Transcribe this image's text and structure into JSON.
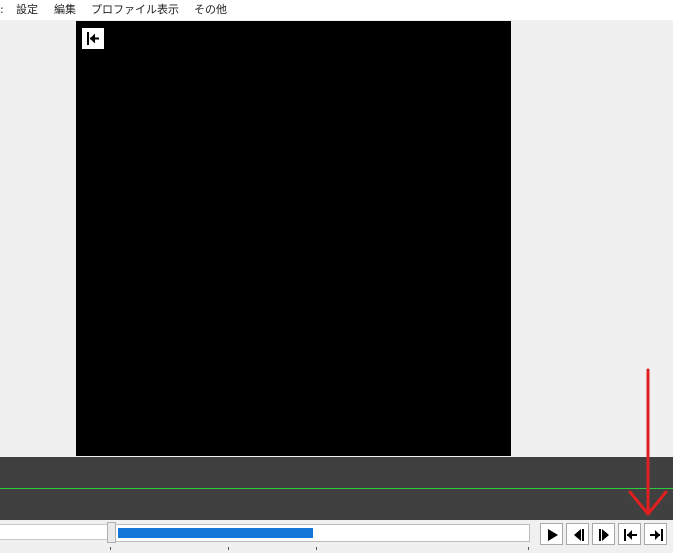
{
  "menu": {
    "items": [
      {
        "label": "設定"
      },
      {
        "label": "編集"
      },
      {
        "label": "プロファイル"
      },
      {
        "label": "表示"
      },
      {
        "label": "その他"
      }
    ]
  },
  "preview": {
    "background": "#000000",
    "back_button_icon": "skip-to-start-icon"
  },
  "timeline": {
    "background": "#404040",
    "line_color": "#2ecc40"
  },
  "seekbar": {
    "progress_fraction": 0.48,
    "fill_color": "#1477d8"
  },
  "controls": [
    {
      "name": "play-button",
      "icon": "play-icon"
    },
    {
      "name": "previous-frame-button",
      "icon": "step-back-icon"
    },
    {
      "name": "next-frame-button",
      "icon": "step-forward-icon"
    },
    {
      "name": "go-to-start-button",
      "icon": "skip-to-start-icon"
    },
    {
      "name": "go-to-end-button",
      "icon": "skip-to-end-icon"
    }
  ],
  "annotation": {
    "color": "#e02020",
    "icon": "red-down-arrow"
  }
}
